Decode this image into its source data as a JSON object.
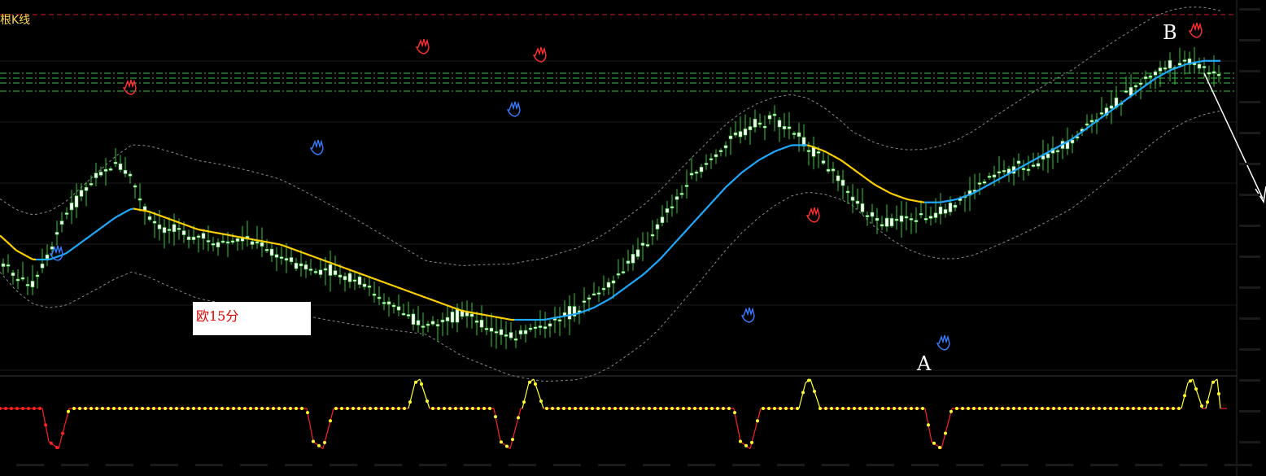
{
  "header": {
    "indicator_text": "根K线"
  },
  "annotation_box": {
    "text": "欧15分"
  },
  "markers": {
    "point_a": "A",
    "point_b": "B"
  },
  "colors": {
    "background": "#000000",
    "candle": "#ffffff",
    "wick": "#32cd32",
    "ma_up": "#20aaff",
    "ma_down": "#ffd000",
    "band": "#8a8a8a",
    "resistance": "#d02020",
    "support_dash": "#3fbf3f",
    "osc_low": "#ff2020",
    "osc_high": "#ffff30",
    "signal_sell": "#ff3030",
    "signal_buy": "#3a7bff",
    "arrow": "#ffffff"
  },
  "chart_data": {
    "type": "candlestick",
    "icons": {
      "sell_signal": "red-hand-icon",
      "buy_signal": "blue-hand-icon",
      "forecast": "down-arrow-icon"
    },
    "price_path": [
      0.3,
      0.24,
      0.22,
      0.33,
      0.45,
      0.52,
      0.58,
      0.62,
      0.57,
      0.44,
      0.4,
      0.39,
      0.38,
      0.36,
      0.36,
      0.37,
      0.35,
      0.31,
      0.28,
      0.26,
      0.27,
      0.24,
      0.22,
      0.18,
      0.14,
      0.1,
      0.08,
      0.1,
      0.12,
      0.09,
      0.06,
      0.05,
      0.06,
      0.08,
      0.1,
      0.14,
      0.18,
      0.22,
      0.28,
      0.34,
      0.42,
      0.5,
      0.57,
      0.63,
      0.68,
      0.72,
      0.75,
      0.77,
      0.73,
      0.68,
      0.62,
      0.55,
      0.48,
      0.44,
      0.42,
      0.43,
      0.44,
      0.46,
      0.49,
      0.53,
      0.57,
      0.6,
      0.61,
      0.63,
      0.66,
      0.7,
      0.75,
      0.79,
      0.83,
      0.88,
      0.92,
      0.95,
      0.96,
      0.94,
      0.9
    ],
    "ma_path": [
      0.38,
      0.33,
      0.3,
      0.3,
      0.32,
      0.36,
      0.4,
      0.44,
      0.47,
      0.46,
      0.44,
      0.42,
      0.4,
      0.39,
      0.38,
      0.37,
      0.36,
      0.35,
      0.33,
      0.31,
      0.29,
      0.27,
      0.25,
      0.23,
      0.21,
      0.19,
      0.17,
      0.15,
      0.13,
      0.12,
      0.11,
      0.1,
      0.1,
      0.1,
      0.11,
      0.12,
      0.14,
      0.17,
      0.21,
      0.25,
      0.3,
      0.36,
      0.42,
      0.48,
      0.54,
      0.59,
      0.63,
      0.66,
      0.68,
      0.68,
      0.66,
      0.63,
      0.59,
      0.55,
      0.52,
      0.5,
      0.49,
      0.49,
      0.5,
      0.52,
      0.55,
      0.58,
      0.61,
      0.64,
      0.67,
      0.7,
      0.74,
      0.78,
      0.82,
      0.86,
      0.9,
      0.93,
      0.95,
      0.96,
      0.96
    ],
    "oscillator": {
      "baseline": 0.6,
      "cycles": [
        {
          "peak": 1.0,
          "trough": 0.05
        },
        {
          "peak": 1.0,
          "trough": 0.05
        },
        {
          "peak": 1.0,
          "trough": 0.05
        },
        {
          "peak": 1.0,
          "trough": 0.05
        },
        {
          "peak": 1.0,
          "trough": 0.05
        }
      ]
    }
  }
}
